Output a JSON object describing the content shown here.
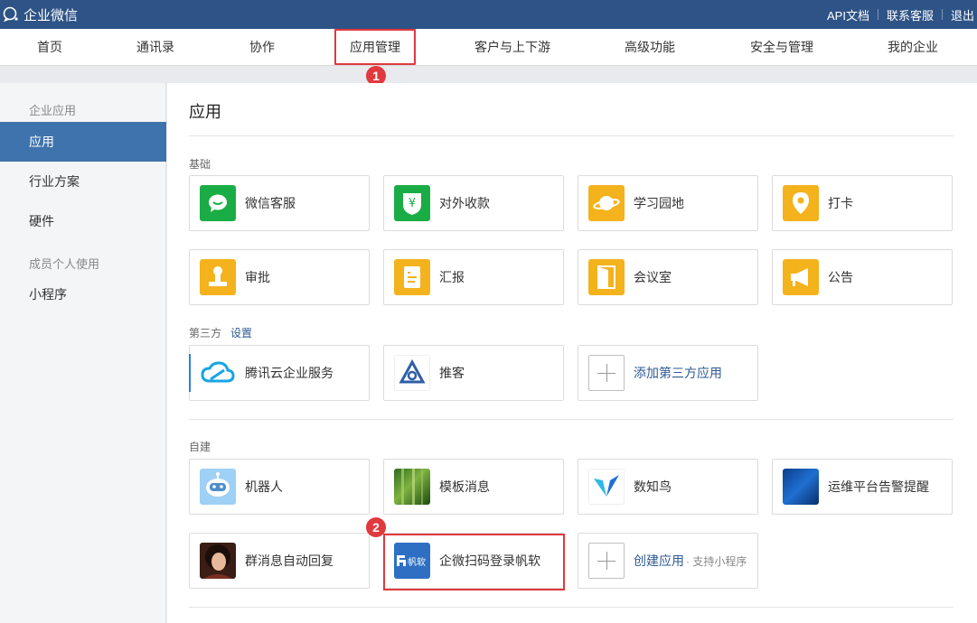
{
  "topbar": {
    "brand": "企业微信",
    "links": [
      "API文档",
      "联系客服",
      "退出"
    ]
  },
  "nav": {
    "items": [
      "首页",
      "通讯录",
      "协作",
      "应用管理",
      "客户与上下游",
      "高级功能",
      "安全与管理",
      "我的企业"
    ],
    "active": "应用管理"
  },
  "annotations": {
    "badge1": "1",
    "badge2": "2"
  },
  "sidebar": {
    "section1": "企业应用",
    "items1": [
      "应用",
      "行业方案",
      "硬件"
    ],
    "section2": "成员个人使用",
    "items2": [
      "小程序"
    ]
  },
  "main": {
    "title": "应用",
    "basic": {
      "label": "基础",
      "apps": [
        {
          "name": "微信客服",
          "icon": "wechat-chat-icon"
        },
        {
          "name": "对外收款",
          "icon": "yuan-shield-icon"
        },
        {
          "name": "学习园地",
          "icon": "planet-icon"
        },
        {
          "name": "打卡",
          "icon": "location-pin-icon"
        },
        {
          "name": "审批",
          "icon": "stamp-icon"
        },
        {
          "name": "汇报",
          "icon": "report-doc-icon"
        },
        {
          "name": "会议室",
          "icon": "door-icon"
        },
        {
          "name": "公告",
          "icon": "megaphone-icon"
        }
      ]
    },
    "thirdparty": {
      "label": "第三方",
      "settings": "设置",
      "apps": [
        {
          "name": "腾讯云企业服务",
          "icon": "tencent-cloud-icon"
        },
        {
          "name": "推客",
          "icon": "tuike-icon"
        },
        {
          "name": "添加第三方应用",
          "icon": "plus-icon"
        }
      ]
    },
    "custom": {
      "label": "自建",
      "apps": [
        {
          "name": "机器人",
          "icon": "robot-icon"
        },
        {
          "name": "模板消息",
          "icon": "bamboo-photo-icon"
        },
        {
          "name": "数知鸟",
          "icon": "bird-v-icon"
        },
        {
          "name": "运维平台告警提醒",
          "icon": "blue-gradient-icon"
        },
        {
          "name": "群消息自动回复",
          "icon": "woman-photo-icon"
        },
        {
          "name": "企微扫码登录帆软",
          "icon": "fanruan-logo-icon",
          "logo_text": "帆软"
        },
        {
          "name": "创建应用",
          "sub": "· 支持小程序",
          "icon": "plus-icon"
        }
      ]
    }
  }
}
